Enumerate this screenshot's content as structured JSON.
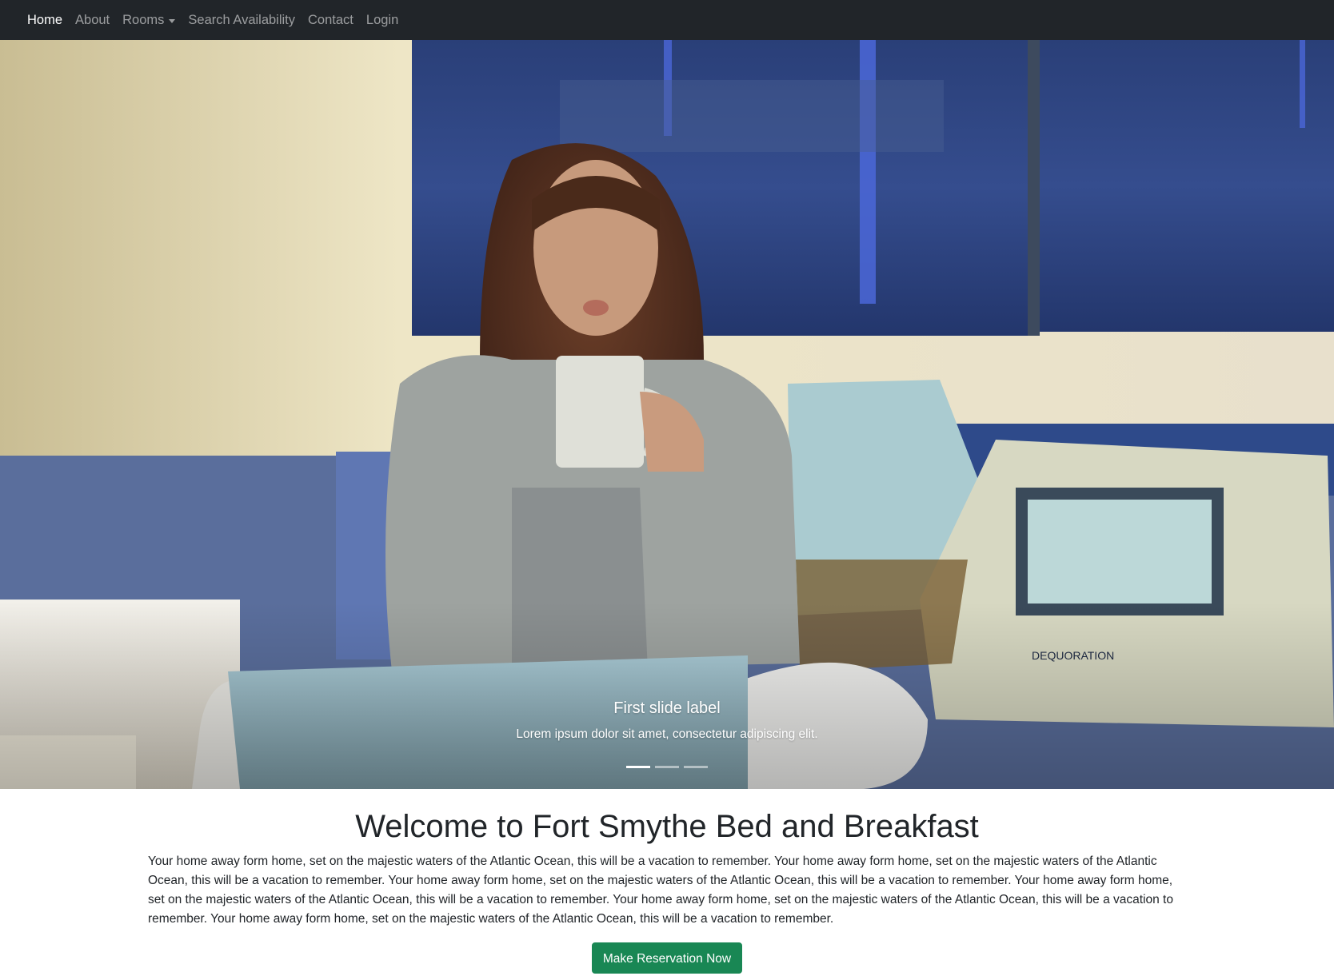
{
  "navbar": {
    "items": [
      {
        "label": "Home",
        "active": true
      },
      {
        "label": "About",
        "active": false
      },
      {
        "label": "Rooms",
        "active": false,
        "dropdown": true
      },
      {
        "label": "Search Availability",
        "active": false
      },
      {
        "label": "Contact",
        "active": false
      },
      {
        "label": "Login",
        "active": false
      }
    ]
  },
  "carousel": {
    "slide_title": "First slide label",
    "slide_text": "Lorem ipsum dolor sit amet, consectetur adipiscing elit.",
    "indicator_count": 3,
    "active_indicator": 1
  },
  "main": {
    "title": "Welcome to Fort Smythe Bed and Breakfast",
    "intro": "Your home away form home, set on the majestic waters of the Atlantic Ocean, this will be a vacation to remember. Your home away form home, set on the majestic waters of the Atlantic Ocean, this will be a vacation to remember. Your home away form home, set on the majestic waters of the Atlantic Ocean, this will be a vacation to remember. Your home away form home, set on the majestic waters of the Atlantic Ocean, this will be a vacation to remember. Your home away form home, set on the majestic waters of the Atlantic Ocean, this will be a vacation to remember. Your home away form home, set on the majestic waters of the Atlantic Ocean, this will be a vacation to remember.",
    "cta_label": "Make Reservation Now"
  },
  "colors": {
    "navbar_bg": "#212529",
    "cta_bg": "#198754"
  }
}
